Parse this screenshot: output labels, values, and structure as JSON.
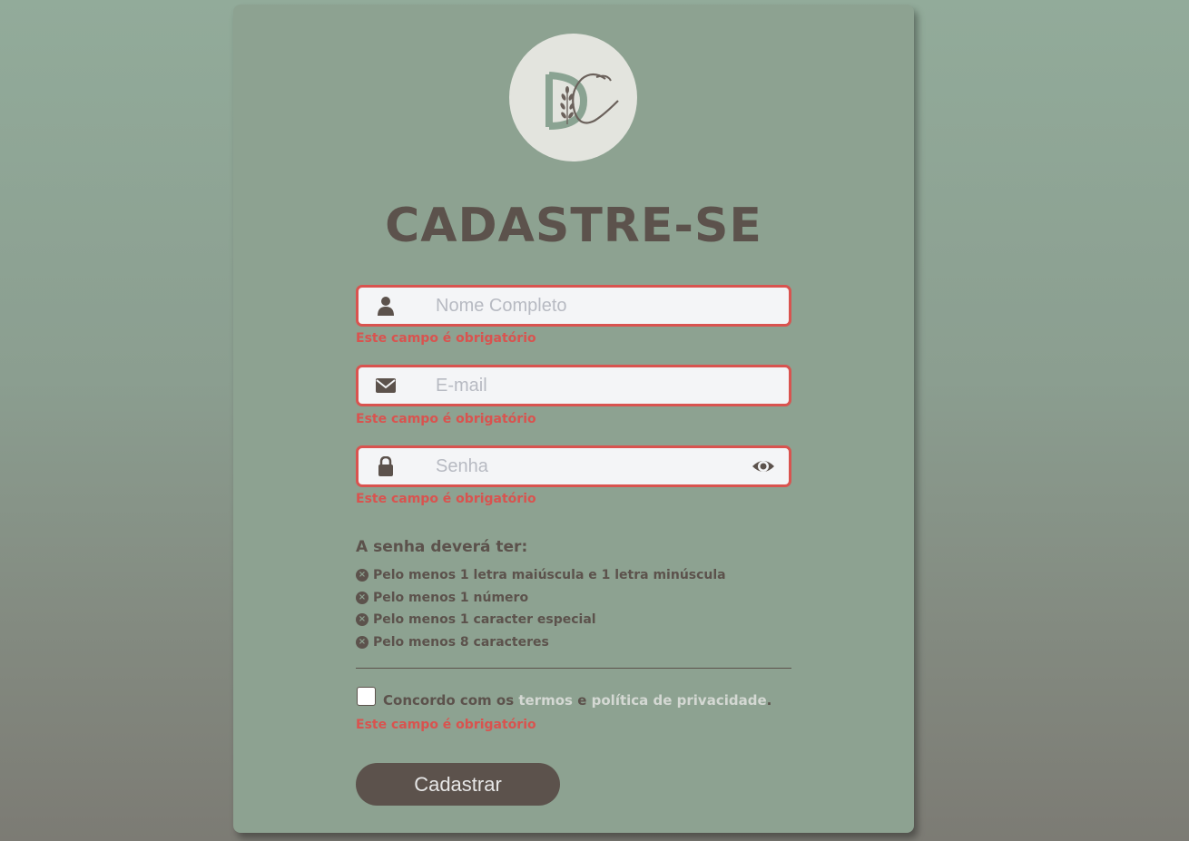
{
  "page": {
    "title": "CADASTRE-SE"
  },
  "logo": {
    "letters": "DC"
  },
  "form": {
    "name": {
      "placeholder": "Nome Completo",
      "value": "",
      "error": "Este campo é obrigatório",
      "icon": "user-icon"
    },
    "email": {
      "placeholder": "E-mail",
      "value": "",
      "error": "Este campo é obrigatório",
      "icon": "envelope-icon"
    },
    "password": {
      "placeholder": "Senha",
      "value": "",
      "error": "Este campo é obrigatório",
      "icon": "lock-icon",
      "toggle_icon": "eye-icon"
    }
  },
  "requirements": {
    "heading": "A senha deverá ter:",
    "items": [
      "Pelo menos 1 letra maiúscula e 1 letra minúscula",
      "Pelo menos 1 número",
      "Pelo menos 1 caracter especial",
      "Pelo menos 8 caracteres"
    ]
  },
  "agreement": {
    "prefix": "Concordo com os",
    "terms_link": "termos",
    "conjunction": "e",
    "privacy_link": "política de privacidade",
    "suffix": ".",
    "error": "Este campo é obrigatório"
  },
  "submit": {
    "label": "Cadastrar"
  },
  "colors": {
    "accent": "#5c524c",
    "error": "#d9534f",
    "card": "#8da291",
    "input_bg": "#f4f5f7"
  }
}
